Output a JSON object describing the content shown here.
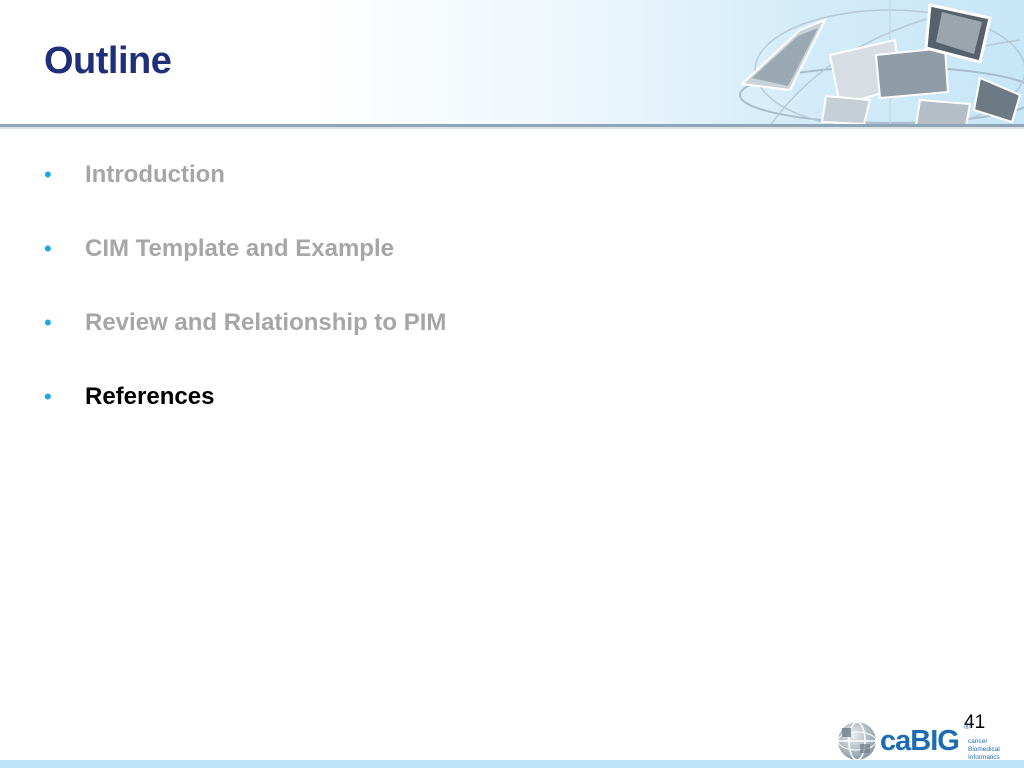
{
  "slide": {
    "title": "Outline",
    "page_number": "41"
  },
  "outline": {
    "items": [
      {
        "label": "Introduction",
        "state": "inactive"
      },
      {
        "label": "CIM Template and Example",
        "state": "inactive"
      },
      {
        "label": "Review and Relationship to PIM",
        "state": "inactive"
      },
      {
        "label": "References",
        "state": "active"
      }
    ],
    "bullet_glyph": "•"
  },
  "logo": {
    "wordmark": "caBIG",
    "registered": "®",
    "tagline": "cancer Biomedical Informatics Grid®"
  },
  "colors": {
    "title": "#1f2f7a",
    "bullet": "#1aa7e8",
    "inactive_text": "#a6a6a6",
    "active_text": "#000000",
    "logo_blue": "#1d6bb0"
  }
}
